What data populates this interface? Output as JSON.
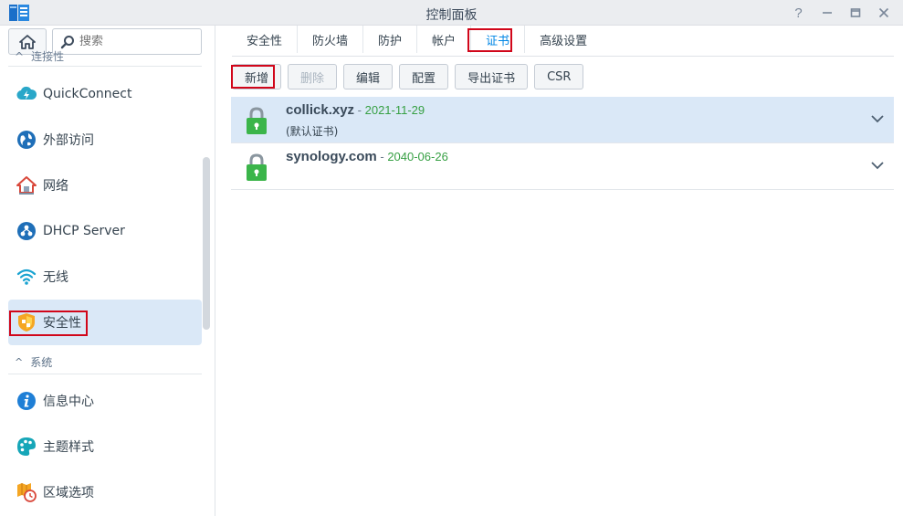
{
  "window": {
    "title": "控制面板",
    "controls": [
      "help-icon",
      "minimize-icon",
      "maximize-icon",
      "close-icon"
    ]
  },
  "sidebar": {
    "search_placeholder": "搜索",
    "cut_group_label": "连接性",
    "items": [
      {
        "label": "QuickConnect",
        "icon": "quickconnect-icon"
      },
      {
        "label": "外部访问",
        "icon": "external-access-icon"
      },
      {
        "label": "网络",
        "icon": "network-icon"
      },
      {
        "label": "DHCP Server",
        "icon": "dhcp-server-icon"
      },
      {
        "label": "无线",
        "icon": "wireless-icon"
      },
      {
        "label": "安全性",
        "icon": "security-icon",
        "active": true
      }
    ],
    "group_system": "系统",
    "system_items": [
      {
        "label": "信息中心",
        "icon": "info-center-icon"
      },
      {
        "label": "主题样式",
        "icon": "theme-icon"
      },
      {
        "label": "区域选项",
        "icon": "regional-options-icon"
      }
    ]
  },
  "tabs": [
    {
      "label": "安全性"
    },
    {
      "label": "防火墙"
    },
    {
      "label": "防护"
    },
    {
      "label": "帐户"
    },
    {
      "label": "证书",
      "active": true
    },
    {
      "label": "高级设置"
    }
  ],
  "toolbar": {
    "add": "新增",
    "delete": "删除",
    "edit": "编辑",
    "config": "配置",
    "export": "导出证书",
    "csr": "CSR"
  },
  "certificates": [
    {
      "name": "collick.xyz",
      "separator": " - ",
      "date": "2021-11-29",
      "note": "(默认证书)"
    },
    {
      "name": "synology.com",
      "separator": " - ",
      "date": "2040-06-26",
      "note": ""
    }
  ],
  "colors": {
    "accent": "#0086e5",
    "selected_bg": "#dae8f7",
    "highlight_border": "#d1061a",
    "date_green": "#37a044",
    "lock_green": "#3bb54a"
  }
}
